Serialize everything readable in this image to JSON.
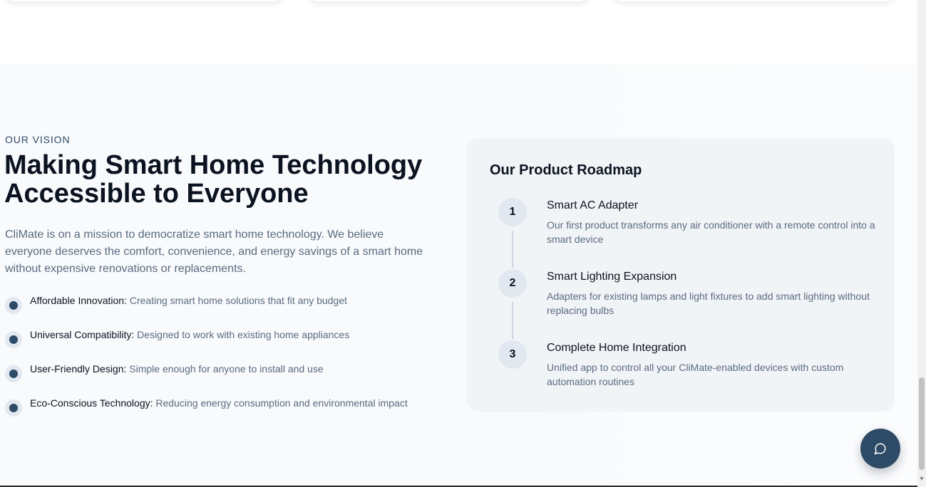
{
  "vision": {
    "eyebrow": "OUR VISION",
    "headline": "Making Smart Home Technology Accessible to Everyone",
    "lead": "CliMate is on a mission to democratize smart home technology. We believe everyone deserves the comfort, convenience, and energy savings of a smart home without expensive renovations or replacements.",
    "bullets": [
      {
        "title": "Affordable Innovation:",
        "desc": "Creating smart home solutions that fit any budget"
      },
      {
        "title": "Universal Compatibility:",
        "desc": "Designed to work with existing home appliances"
      },
      {
        "title": "User-Friendly Design:",
        "desc": "Simple enough for anyone to install and use"
      },
      {
        "title": "Eco-Conscious Technology:",
        "desc": "Reducing energy consumption and environmental impact"
      }
    ]
  },
  "roadmap": {
    "title": "Our Product Roadmap",
    "steps": [
      {
        "num": "1",
        "title": "Smart AC Adapter",
        "desc": "Our first product transforms any air conditioner with a remote control into a smart device"
      },
      {
        "num": "2",
        "title": "Smart Lighting Expansion",
        "desc": "Adapters for existing lamps and light fixtures to add smart lighting without replacing bulbs"
      },
      {
        "num": "3",
        "title": "Complete Home Integration",
        "desc": "Unified app to control all your CliMate-enabled devices with custom automation routines"
      }
    ]
  },
  "chat": {
    "icon": "chat-bubble-icon"
  },
  "colors": {
    "accent": "#2d4a66",
    "heading": "#0b1220",
    "muted": "#5b6b7f",
    "card": "#f1f4f7"
  }
}
